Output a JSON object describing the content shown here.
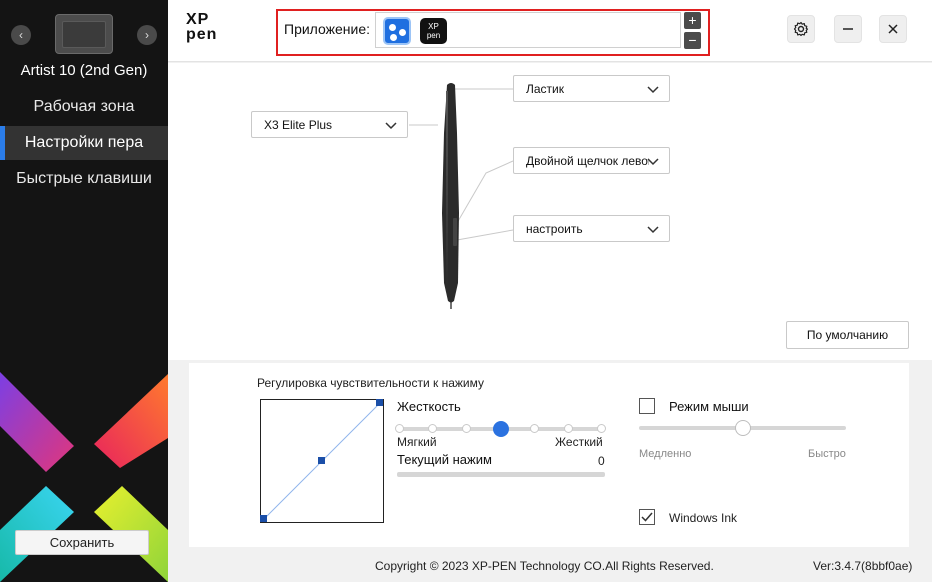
{
  "sidebar": {
    "device_name": "Artist 10 (2nd Gen)",
    "prev_icon": "chevron-left-icon",
    "next_icon": "chevron-right-icon",
    "items": [
      {
        "label": "Рабочая зона",
        "active": false
      },
      {
        "label": "Настройки пера",
        "active": true
      },
      {
        "label": "Быстрые клавиши",
        "active": false
      }
    ],
    "save_label": "Сохранить",
    "active_color": "#2b7de9"
  },
  "header": {
    "logo_line1": "XP",
    "logo_line2": "pen",
    "app_label": "Приложение:",
    "apps": [
      {
        "icon": "all-apps-icon",
        "color": "#1f6fe0"
      },
      {
        "icon": "xppen-app-icon",
        "text_line1": "XP",
        "text_line2": "pen"
      }
    ],
    "add_label": "+",
    "remove_label": "−",
    "settings_icon": "gear-icon",
    "minimize_icon": "minimize-icon",
    "close_icon": "close-icon"
  },
  "pen": {
    "pen_model": "X3 Elite Plus",
    "top_button": "Ластик",
    "upper_button": "Двойной щелчок левой",
    "lower_button": "настроить",
    "default_label": "По умолчанию"
  },
  "pressure": {
    "title": "Регулировка чувствительности к нажиму",
    "hardness_label": "Жесткость",
    "soft_label": "Мягкий",
    "hard_label": "Жесткий",
    "hardness_level": 0.5,
    "current_label": "Текущий нажим",
    "current_value": "0",
    "accent_color": "#2b72e0"
  },
  "mouse": {
    "mode_label": "Режим мыши",
    "mode_checked": false,
    "slow_label": "Медленно",
    "fast_label": "Быстро",
    "speed_level": 0.5,
    "windows_ink_label": "Windows Ink",
    "windows_ink_checked": true
  },
  "footer": {
    "copyright": "Copyright © 2023  XP-PEN Technology CO.All Rights Reserved.",
    "version": "Ver:3.4.7(8bbf0ae)"
  }
}
